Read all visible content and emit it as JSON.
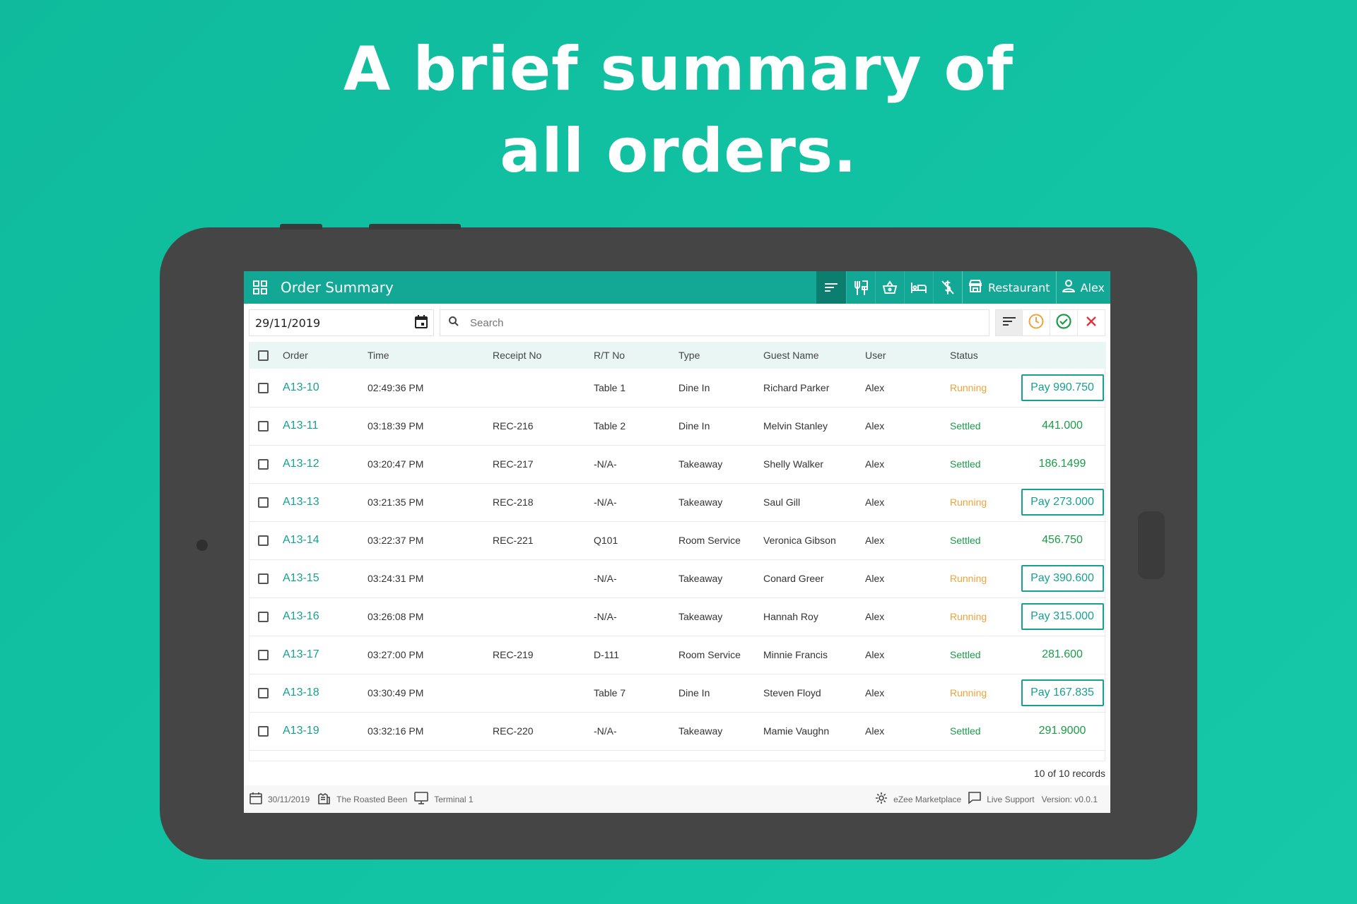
{
  "headline": {
    "line1": "A brief summary of",
    "line2": "all orders."
  },
  "topbar": {
    "title": "Order Summary",
    "outlet": "Restaurant",
    "user": "Alex"
  },
  "filters": {
    "date": "29/11/2019",
    "search_placeholder": "Search"
  },
  "table": {
    "columns": [
      "Order",
      "Time",
      "Receipt No",
      "R/T No",
      "Type",
      "Guest Name",
      "User",
      "Status"
    ],
    "rows": [
      {
        "order": "A13-10",
        "time": "02:49:36 PM",
        "receipt": "",
        "rt": "Table 1",
        "type": "Dine In",
        "guest": "Richard Parker",
        "user": "Alex",
        "status": "Running",
        "amount": "Pay 990.750"
      },
      {
        "order": "A13-11",
        "time": "03:18:39 PM",
        "receipt": "REC-216",
        "rt": "Table 2",
        "type": "Dine In",
        "guest": "Melvin Stanley",
        "user": "Alex",
        "status": "Settled",
        "amount": "441.000"
      },
      {
        "order": "A13-12",
        "time": "03:20:47 PM",
        "receipt": "REC-217",
        "rt": "-N/A-",
        "type": "Takeaway",
        "guest": "Shelly Walker",
        "user": "Alex",
        "status": "Settled",
        "amount": "186.1499"
      },
      {
        "order": "A13-13",
        "time": "03:21:35 PM",
        "receipt": "REC-218",
        "rt": "-N/A-",
        "type": "Takeaway",
        "guest": "Saul Gill",
        "user": "Alex",
        "status": "Running",
        "amount": "Pay 273.000"
      },
      {
        "order": "A13-14",
        "time": "03:22:37 PM",
        "receipt": "REC-221",
        "rt": "Q101",
        "type": "Room Service",
        "guest": "Veronica Gibson",
        "user": "Alex",
        "status": "Settled",
        "amount": "456.750"
      },
      {
        "order": "A13-15",
        "time": "03:24:31 PM",
        "receipt": "",
        "rt": "-N/A-",
        "type": "Takeaway",
        "guest": "Conard Greer",
        "user": "Alex",
        "status": "Running",
        "amount": "Pay 390.600"
      },
      {
        "order": "A13-16",
        "time": "03:26:08 PM",
        "receipt": "",
        "rt": "-N/A-",
        "type": "Takeaway",
        "guest": "Hannah Roy",
        "user": "Alex",
        "status": "Running",
        "amount": "Pay 315.000"
      },
      {
        "order": "A13-17",
        "time": "03:27:00 PM",
        "receipt": "REC-219",
        "rt": "D-111",
        "type": "Room Service",
        "guest": "Minnie Francis",
        "user": "Alex",
        "status": "Settled",
        "amount": "281.600"
      },
      {
        "order": "A13-18",
        "time": "03:30:49 PM",
        "receipt": "",
        "rt": "Table 7",
        "type": "Dine In",
        "guest": "Steven Floyd",
        "user": "Alex",
        "status": "Running",
        "amount": "Pay 167.835"
      },
      {
        "order": "A13-19",
        "time": "03:32:16 PM",
        "receipt": "REC-220",
        "rt": "-N/A-",
        "type": "Takeaway",
        "guest": "Mamie Vaughn",
        "user": "Alex",
        "status": "Settled",
        "amount": "291.9000"
      }
    ]
  },
  "records_text": "10 of 10 records",
  "footer": {
    "date": "30/11/2019",
    "property": "The Roasted Been",
    "terminal": "Terminal 1",
    "marketplace": "eZee Marketplace",
    "support": "Live Support",
    "version": "Version: v0.0.1"
  },
  "colors": {
    "background": "#12c4a4",
    "topbar": "#13a896",
    "running": "#f0a33b",
    "settled": "#1a9c48",
    "cancel": "#e0353c"
  },
  "icons": {
    "topbar": [
      "apps-icon",
      "sort-icon",
      "dining-icon",
      "basket-icon",
      "bed-icon",
      "no-dollar-icon",
      "store-icon",
      "user-icon"
    ],
    "filters": [
      "calendar-icon",
      "search-icon",
      "sort-icon",
      "clock-icon",
      "check-circle-icon",
      "close-icon"
    ]
  }
}
